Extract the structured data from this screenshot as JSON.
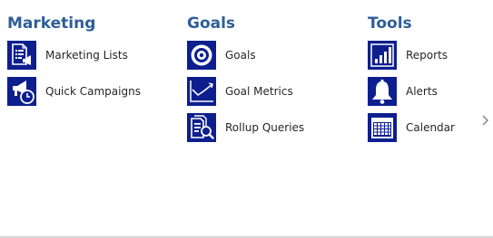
{
  "groups": [
    {
      "title": "Marketing",
      "items": [
        {
          "label": "Marketing Lists",
          "icon": "marketing-list-icon"
        },
        {
          "label": "Quick Campaigns",
          "icon": "megaphone-clock-icon"
        }
      ]
    },
    {
      "title": "Goals",
      "items": [
        {
          "label": "Goals",
          "icon": "target-icon"
        },
        {
          "label": "Goal Metrics",
          "icon": "line-chart-icon"
        },
        {
          "label": "Rollup Queries",
          "icon": "document-search-icon"
        }
      ]
    },
    {
      "title": "Tools",
      "items": [
        {
          "label": "Reports",
          "icon": "bar-report-icon"
        },
        {
          "label": "Alerts",
          "icon": "bell-icon"
        },
        {
          "label": "Calendar",
          "icon": "calendar-icon"
        }
      ]
    }
  ],
  "navigation": {
    "next_icon": "chevron-right-icon"
  },
  "colors": {
    "heading": "#2e5e97",
    "icon_tile": "#0d1f8e",
    "label_text": "#262626",
    "chevron": "#7a7a7a",
    "divider": "#d6d6d6"
  }
}
